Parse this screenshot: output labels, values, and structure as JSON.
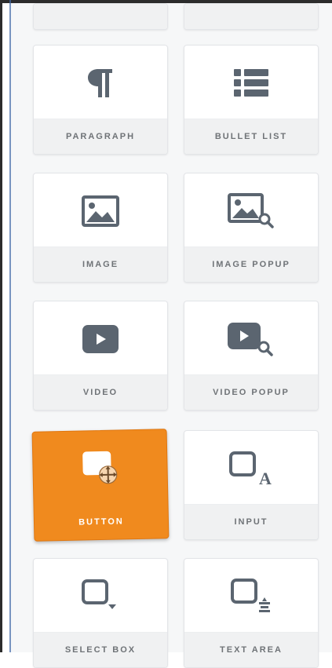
{
  "elements": [
    {
      "id": "paragraph",
      "label": "PARAGRAPH",
      "icon": "paragraph-icon"
    },
    {
      "id": "bullet-list",
      "label": "BULLET LIST",
      "icon": "bullet-list-icon"
    },
    {
      "id": "image",
      "label": "IMAGE",
      "icon": "image-icon"
    },
    {
      "id": "image-popup",
      "label": "IMAGE POPUP",
      "icon": "image-popup-icon"
    },
    {
      "id": "video",
      "label": "VIDEO",
      "icon": "video-icon"
    },
    {
      "id": "video-popup",
      "label": "VIDEO POPUP",
      "icon": "video-popup-icon"
    },
    {
      "id": "button",
      "label": "BUTTON",
      "icon": "button-icon",
      "state": "dragging"
    },
    {
      "id": "input",
      "label": "INPUT",
      "icon": "input-icon"
    },
    {
      "id": "select-box",
      "label": "SELECT BOX",
      "icon": "select-box-icon"
    },
    {
      "id": "text-area",
      "label": "TEXT AREA",
      "icon": "text-area-icon"
    }
  ],
  "colors": {
    "accent": "#f08a1e",
    "icon": "#5b6570",
    "label": "#6f7377"
  }
}
